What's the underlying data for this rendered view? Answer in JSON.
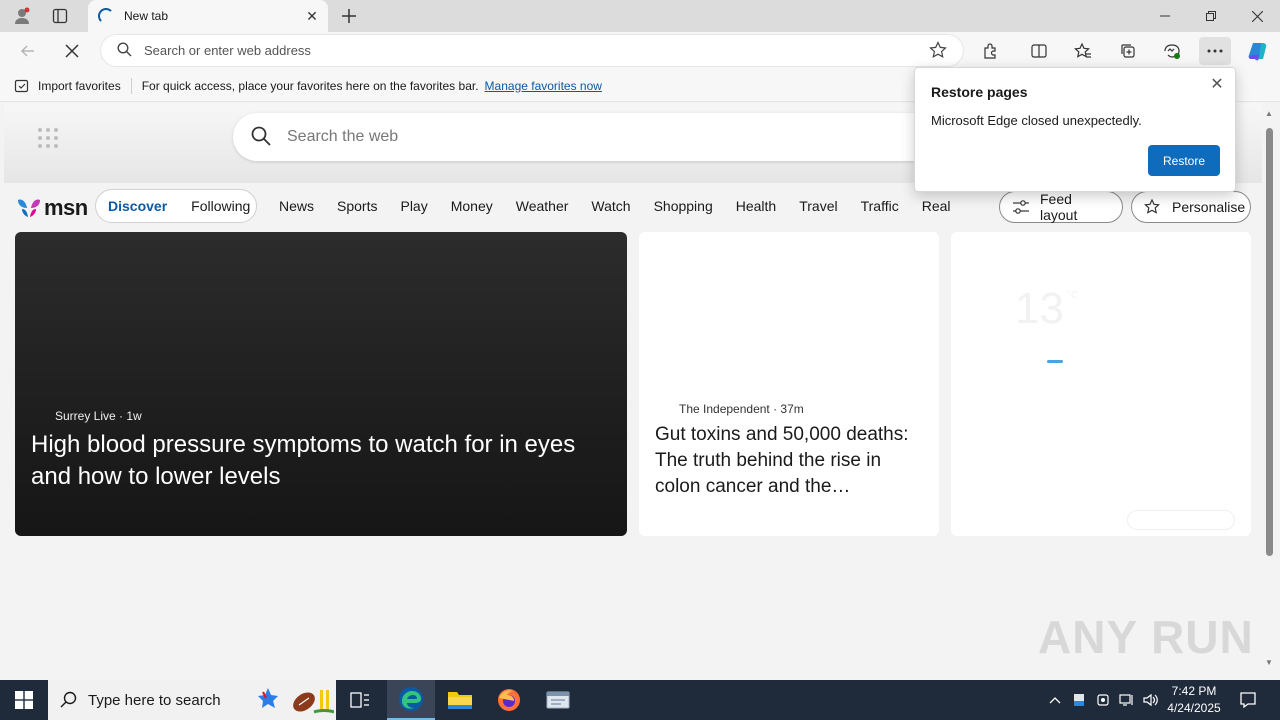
{
  "browser": {
    "tab_title": "New tab",
    "address_placeholder": "Search or enter web address"
  },
  "favorites_bar": {
    "import_label": "Import favorites",
    "hint": "For quick access, place your favorites here on the favorites bar.",
    "manage_link": "Manage favorites now"
  },
  "msn": {
    "logo_text": "msn",
    "search_placeholder": "Search the web",
    "feed_tabs": [
      "Discover",
      "Following"
    ],
    "categories": [
      "News",
      "Sports",
      "Play",
      "Money",
      "Weather",
      "Watch",
      "Shopping",
      "Health",
      "Travel",
      "Traffic",
      "Real E"
    ],
    "feed_layout_label": "Feed layout",
    "personalise_label": "Personalise"
  },
  "cards": {
    "hero": {
      "source": "Surrey Live",
      "age": "1w",
      "headline": "High blood pressure symptoms to watch for in eyes and how to lower levels"
    },
    "secondary": {
      "source": "The Independent",
      "age": "37m",
      "headline": "Gut toxins and 50,000 deaths: The truth behind the rise in colon cancer and the…"
    },
    "weather": {
      "temperature": "13",
      "unit": "°C"
    }
  },
  "popup": {
    "title": "Restore pages",
    "message": "Microsoft Edge closed unexpectedly.",
    "restore_label": "Restore"
  },
  "watermark": "ANY RUN",
  "taskbar": {
    "search_placeholder": "Type here to search",
    "time": "7:42 PM",
    "date": "4/24/2025"
  },
  "colors": {
    "accent": "#0f6cbd",
    "link": "#0c59a4",
    "taskbar": "#1f2a3a"
  }
}
